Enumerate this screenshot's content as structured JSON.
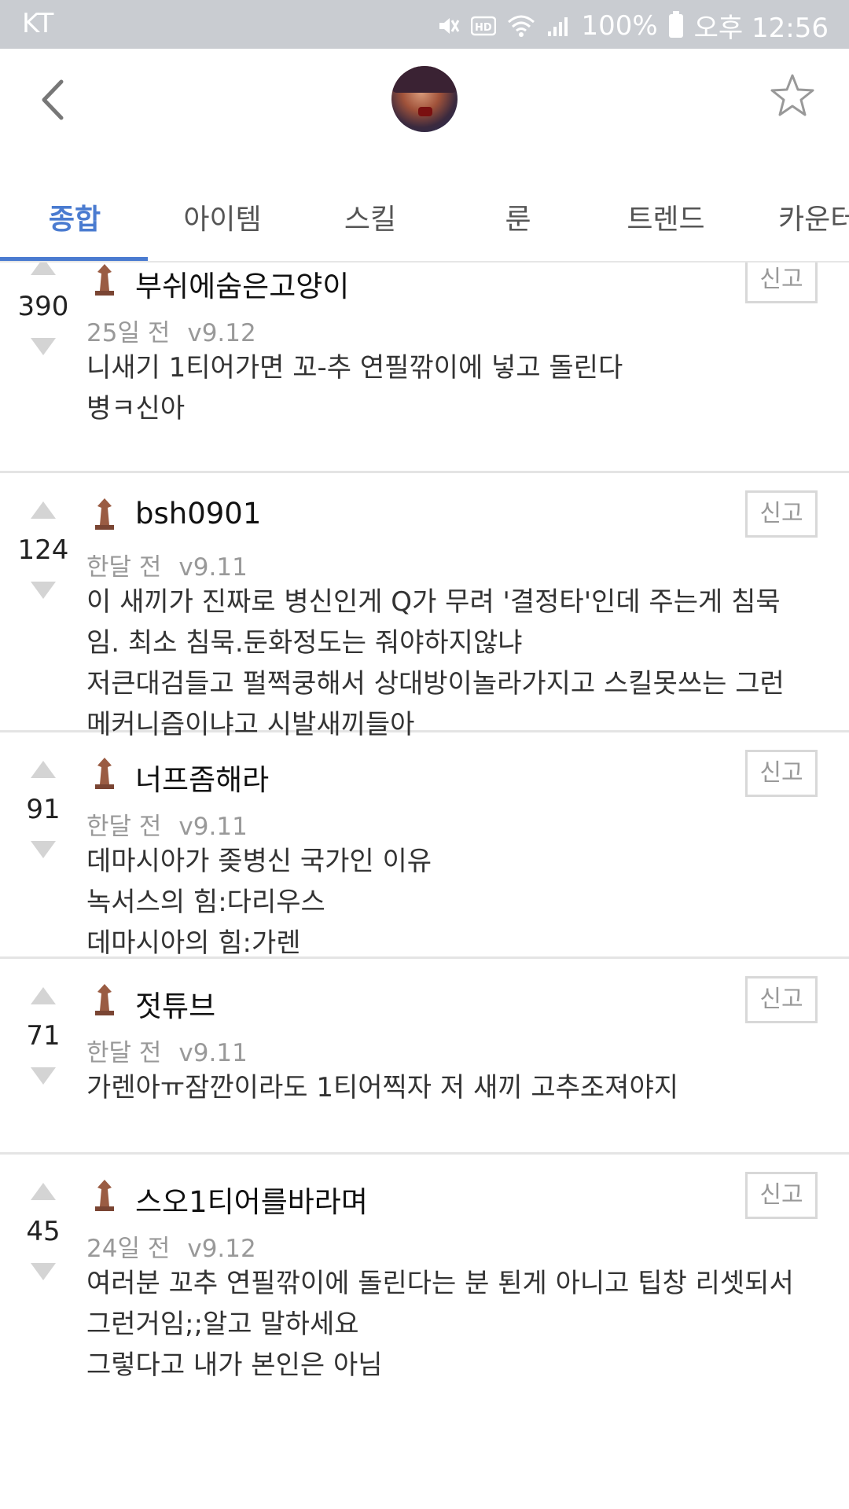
{
  "status_bar": {
    "carrier": "KT",
    "battery": "100%",
    "time": "오후 12:56",
    "icons": [
      "mute-icon",
      "hd-icon",
      "wifi-icon",
      "signal-icon",
      "battery-icon"
    ]
  },
  "header": {
    "icons": [
      "back-icon",
      "champion-avatar",
      "favorite-star-icon"
    ]
  },
  "tabs": [
    {
      "label": "종합",
      "active": true
    },
    {
      "label": "아이템",
      "active": false
    },
    {
      "label": "스킬",
      "active": false
    },
    {
      "label": "룬",
      "active": false
    },
    {
      "label": "트렌드",
      "active": false
    },
    {
      "label": "카운터",
      "active": false
    }
  ],
  "comments": [
    {
      "votes": "390",
      "user": "부쉬에숨은고양이",
      "time": "25일 전",
      "version": "v9.12",
      "report_label": "신고",
      "lines": [
        "니새기 1티어가면 꼬-추 연필깎이에 넣고 돌린다",
        "병ㅋ신아"
      ]
    },
    {
      "votes": "124",
      "user": "bsh0901",
      "time": "한달 전",
      "version": "v9.11",
      "report_label": "신고",
      "lines": [
        "이 새끼가 진짜로 병신인게 Q가 무려 '결정타'인데 주는게 침묵",
        "임. 최소 침묵.둔화정도는 줘야하지않냐",
        "저큰대검들고 펄쩍쿵해서 상대방이놀라가지고 스킬못쓰는 그런",
        "메커니즘이냐고 시발새끼들아"
      ]
    },
    {
      "votes": "91",
      "user": "너프좀해라",
      "time": "한달 전",
      "version": "v9.11",
      "report_label": "신고",
      "lines": [
        "데마시아가 좆병신 국가인 이유",
        "녹서스의 힘:다리우스",
        "데마시아의 힘:가렌"
      ]
    },
    {
      "votes": "71",
      "user": "젓튜브",
      "time": "한달 전",
      "version": "v9.11",
      "report_label": "신고",
      "lines": [
        "가렌아ㅠ잠깐이라도 1티어찍자 저 새끼 고추조져야지"
      ]
    },
    {
      "votes": "45",
      "user": "스오1티어를바라며",
      "time": "24일 전",
      "version": "v9.12",
      "report_label": "신고",
      "lines": [
        "여러분 꼬추 연필깎이에 돌린다는 분 퇸게 아니고 팁창 리셋되서",
        "그런거임;;알고 말하세요",
        "그렇다고 내가 본인은 아님"
      ]
    }
  ]
}
